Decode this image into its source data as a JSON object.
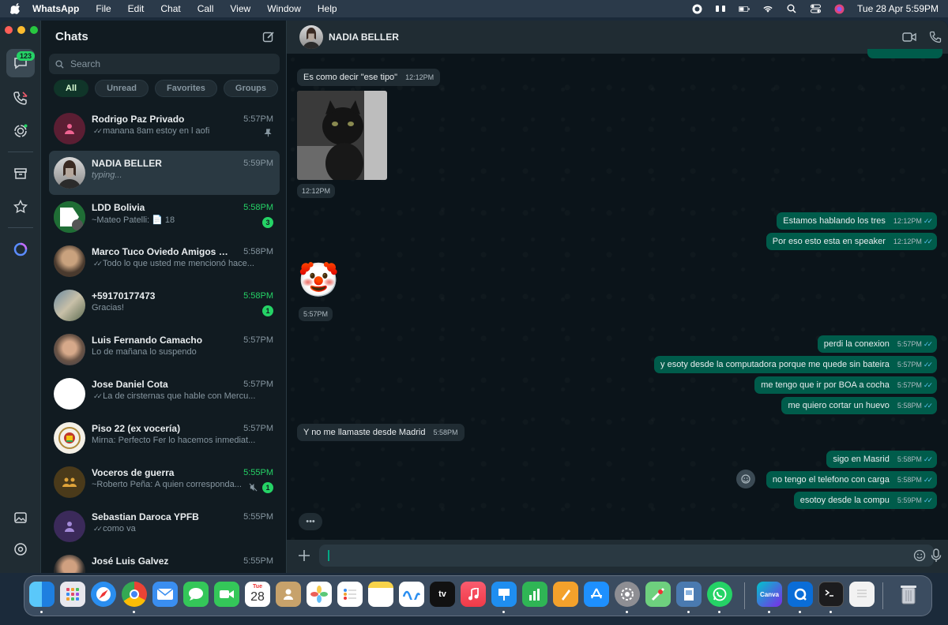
{
  "menubar": {
    "app_name": "WhatsApp",
    "menus": [
      "File",
      "Edit",
      "Chat",
      "Call",
      "View",
      "Window",
      "Help"
    ],
    "clock": "Tue 28 Apr  5:59PM"
  },
  "rail": {
    "chats_badge": "123"
  },
  "chatlist": {
    "title": "Chats",
    "search_placeholder": "Search",
    "filters": [
      "All",
      "Unread",
      "Favorites",
      "Groups"
    ],
    "chats": [
      {
        "name": "Rodrigo Paz Privado",
        "time": "5:57PM",
        "preview": "manana 8am estoy en l aofi",
        "ticks": true,
        "pinned": true
      },
      {
        "name": "NADIA BELLER",
        "time": "5:59PM",
        "preview": "typing...",
        "active": true
      },
      {
        "name": "LDD Bolivia",
        "time": "5:58PM",
        "preview": "~Mateo Patelli: 📄 18",
        "unread": "3"
      },
      {
        "name": "Marco Tuco Oviedo Amigos Miri...",
        "time": "5:58PM",
        "preview": "Todo lo que usted me mencionó hace...",
        "ticks": true
      },
      {
        "name": "+59170177473",
        "time": "5:58PM",
        "preview": "Gracias!",
        "unread": "1"
      },
      {
        "name": "Luis Fernando Camacho",
        "time": "5:57PM",
        "preview": "Lo de mañana lo suspendo"
      },
      {
        "name": "Jose Daniel Cota",
        "time": "5:57PM",
        "preview": "La de cirsternas que hable con Mercu...",
        "ticks": true
      },
      {
        "name": "Piso 22 (ex vocería)",
        "time": "5:57PM",
        "preview": "Mirna: Perfecto Fer lo hacemos inmediat..."
      },
      {
        "name": "Voceros de guerra",
        "time": "5:55PM",
        "preview": "~Roberto Peña: A quien corresponda...",
        "unread": "1",
        "muted": true
      },
      {
        "name": "Sebastian Daroca YPFB",
        "time": "5:55PM",
        "preview": "como va",
        "ticks": true
      },
      {
        "name": "José Luis Galvez",
        "time": "5:55PM",
        "preview": ""
      }
    ]
  },
  "conversation": {
    "contact": "NADIA BELLER",
    "messages": [
      {
        "dir": "in",
        "text": "Es como decir \"ese tipo\"",
        "time": "12:12PM"
      },
      {
        "dir": "in",
        "kind": "image",
        "time": "12:12PM"
      },
      {
        "dir": "out",
        "text": "Estamos hablando los tres",
        "time": "12:12PM"
      },
      {
        "dir": "out",
        "text": "Por eso esto esta en speaker",
        "time": "12:12PM"
      },
      {
        "dir": "in",
        "kind": "emoji",
        "text": "🤡",
        "time": "5:57PM"
      },
      {
        "dir": "out",
        "text": "perdi la conexion",
        "time": "5:57PM"
      },
      {
        "dir": "out",
        "text": "y esoty desde la computadora porque me quede sin bateira",
        "time": "5:57PM"
      },
      {
        "dir": "out",
        "text": "me tengo que ir por BOA a cocha",
        "time": "5:57PM"
      },
      {
        "dir": "out",
        "text": "me quiero cortar un huevo",
        "time": "5:58PM"
      },
      {
        "dir": "in",
        "text": "Y no me llamaste desde Madrid",
        "time": "5:58PM"
      },
      {
        "dir": "out",
        "text": "sigo en Masrid",
        "time": "5:58PM"
      },
      {
        "dir": "out",
        "text": "no tengo el telefono con carga",
        "time": "5:58PM"
      },
      {
        "dir": "out",
        "text": "esotoy desde la compu",
        "time": "5:59PM"
      }
    ],
    "typing_indicator": "•••"
  },
  "dock": {
    "calendar_month": "Tue",
    "calendar_day": "28",
    "canva_label": "Canva",
    "appletv_label": "tv",
    "apps": [
      "finder",
      "launchpad",
      "safari",
      "chrome",
      "mail",
      "messages",
      "facetime",
      "calendar",
      "contacts",
      "photos",
      "reminders",
      "notes",
      "freeform",
      "appletv",
      "music",
      "keynote",
      "numbers",
      "pages",
      "appstore",
      "settings",
      "maps",
      "preview",
      "whatsapp",
      "canva",
      "quick-assist",
      "terminal",
      "text-editor",
      "trash"
    ]
  }
}
